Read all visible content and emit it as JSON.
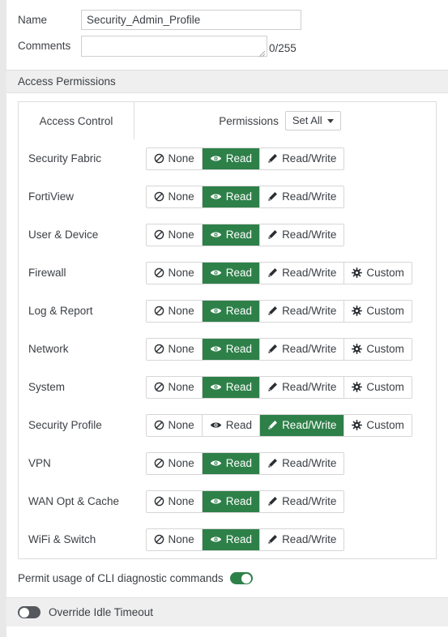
{
  "form": {
    "name_label": "Name",
    "name_value": "Security_Admin_Profile",
    "comments_label": "Comments",
    "comments_value": "",
    "comments_placeholder": "",
    "char_counter": "0/255"
  },
  "section": {
    "access_permissions_title": "Access Permissions"
  },
  "table": {
    "col_access_control": "Access Control",
    "col_permissions": "Permissions",
    "set_all_label": "Set All",
    "option_labels": {
      "none": "None",
      "read": "Read",
      "readwrite": "Read/Write",
      "custom": "Custom"
    },
    "rows": [
      {
        "name": "Security Fabric",
        "options": [
          "none",
          "read",
          "readwrite"
        ],
        "selected": "read"
      },
      {
        "name": "FortiView",
        "options": [
          "none",
          "read",
          "readwrite"
        ],
        "selected": "read"
      },
      {
        "name": "User & Device",
        "options": [
          "none",
          "read",
          "readwrite"
        ],
        "selected": "read"
      },
      {
        "name": "Firewall",
        "options": [
          "none",
          "read",
          "readwrite",
          "custom"
        ],
        "selected": "read"
      },
      {
        "name": "Log & Report",
        "options": [
          "none",
          "read",
          "readwrite",
          "custom"
        ],
        "selected": "read"
      },
      {
        "name": "Network",
        "options": [
          "none",
          "read",
          "readwrite",
          "custom"
        ],
        "selected": "read"
      },
      {
        "name": "System",
        "options": [
          "none",
          "read",
          "readwrite",
          "custom"
        ],
        "selected": "read"
      },
      {
        "name": "Security Profile",
        "options": [
          "none",
          "read",
          "readwrite",
          "custom"
        ],
        "selected": "readwrite"
      },
      {
        "name": "VPN",
        "options": [
          "none",
          "read",
          "readwrite"
        ],
        "selected": "read"
      },
      {
        "name": "WAN Opt & Cache",
        "options": [
          "none",
          "read",
          "readwrite"
        ],
        "selected": "read"
      },
      {
        "name": "WiFi & Switch",
        "options": [
          "none",
          "read",
          "readwrite"
        ],
        "selected": "read"
      }
    ]
  },
  "footer": {
    "cli_label": "Permit usage of CLI diagnostic commands",
    "cli_enabled": true,
    "override_label": "Override Idle Timeout",
    "override_enabled": false
  },
  "colors": {
    "accent_green": "#2e8049",
    "toggle_off": "#55595e",
    "section_bg": "#efefef",
    "border": "#dddddd",
    "text": "#3b3f44"
  },
  "icons": {
    "none": "no-entry-icon",
    "read": "eye-icon",
    "readwrite": "pencil-icon",
    "custom": "gear-icon",
    "set_all": "chevron-down-icon",
    "resize": "resize-grip-icon"
  }
}
